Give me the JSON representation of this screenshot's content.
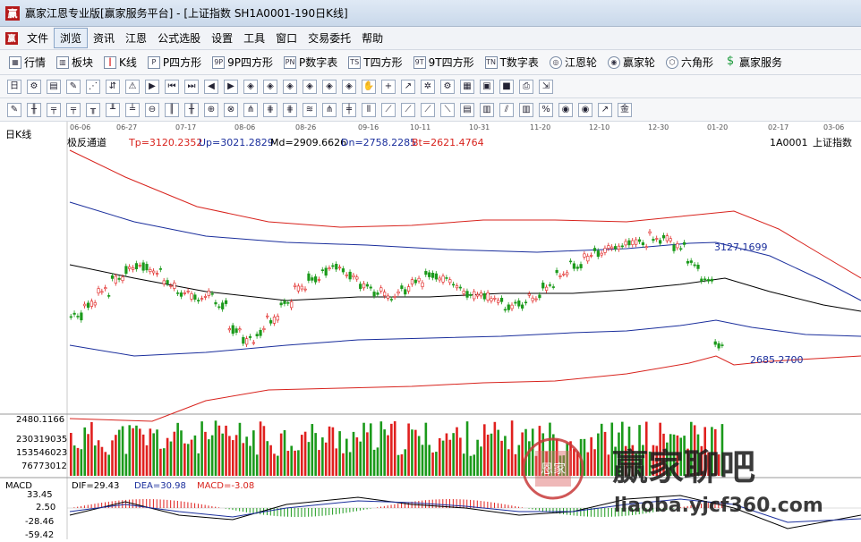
{
  "window": {
    "title": "赢家江恩专业版[赢家服务平台] - [上证指数  SH1A0001-190日K线]"
  },
  "menu": [
    "文件",
    "浏览",
    "资讯",
    "江恩",
    "公式选股",
    "设置",
    "工具",
    "窗口",
    "交易委托",
    "帮助"
  ],
  "toolbar_main": [
    {
      "label": "行情",
      "icon": "grid-icon"
    },
    {
      "label": "板块",
      "icon": "blocks-icon"
    },
    {
      "label": "K线",
      "icon": "candle-icon"
    },
    {
      "label": "P四方形",
      "icon": "p-square-icon"
    },
    {
      "label": "9P四方形",
      "icon": "9p-square-icon"
    },
    {
      "label": "P数字表",
      "icon": "pn-table-icon"
    },
    {
      "label": "T四方形",
      "icon": "t-square-icon"
    },
    {
      "label": "9T四方形",
      "icon": "9t-square-icon"
    },
    {
      "label": "T数字表",
      "icon": "tn-table-icon"
    },
    {
      "label": "江恩轮",
      "icon": "gann-wheel-icon"
    },
    {
      "label": "赢家轮",
      "icon": "winner-wheel-icon"
    },
    {
      "label": "六角形",
      "icon": "hexagon-icon"
    },
    {
      "label": "赢家服务",
      "icon": "dollar-icon"
    }
  ],
  "chart_header": {
    "period": "日K线",
    "indicator": "极反通道",
    "tp": "Tp=3120.2352",
    "up": "Up=3021.2829",
    "md": "Md=2909.6626",
    "dn": "Dn=2758.2285",
    "bt": "Bt=2621.4764",
    "code": "1A0001",
    "name": "上证指数"
  },
  "date_ticks": [
    "06-06",
    "06-27",
    "07-17",
    "08-06",
    "08-26",
    "09-16",
    "10-11",
    "10-31",
    "11-20",
    "12-10",
    "12-30",
    "01-20",
    "02-17",
    "03-06"
  ],
  "price_labels": {
    "high": "3127.1699",
    "low": "2685.2700",
    "axis_min": "2480.1166"
  },
  "volume_axis": [
    "230319035",
    "153546023",
    "76773012"
  ],
  "macd": {
    "title": "MACD",
    "dif": "DIF=29.43",
    "dea": "DEA=30.98",
    "macd": "MACD=-3.08",
    "axis": [
      "33.45",
      "2.50",
      "-28.46",
      "-59.42"
    ]
  },
  "watermark": {
    "text": "赢家聊吧",
    "url": "liaoba.yjcf360.com",
    "seal": "恩家"
  },
  "colors": {
    "up": "#e0201e",
    "down": "#1b9a1b",
    "blue": "#1a2e9c",
    "red_channel": "#d8231d"
  }
}
